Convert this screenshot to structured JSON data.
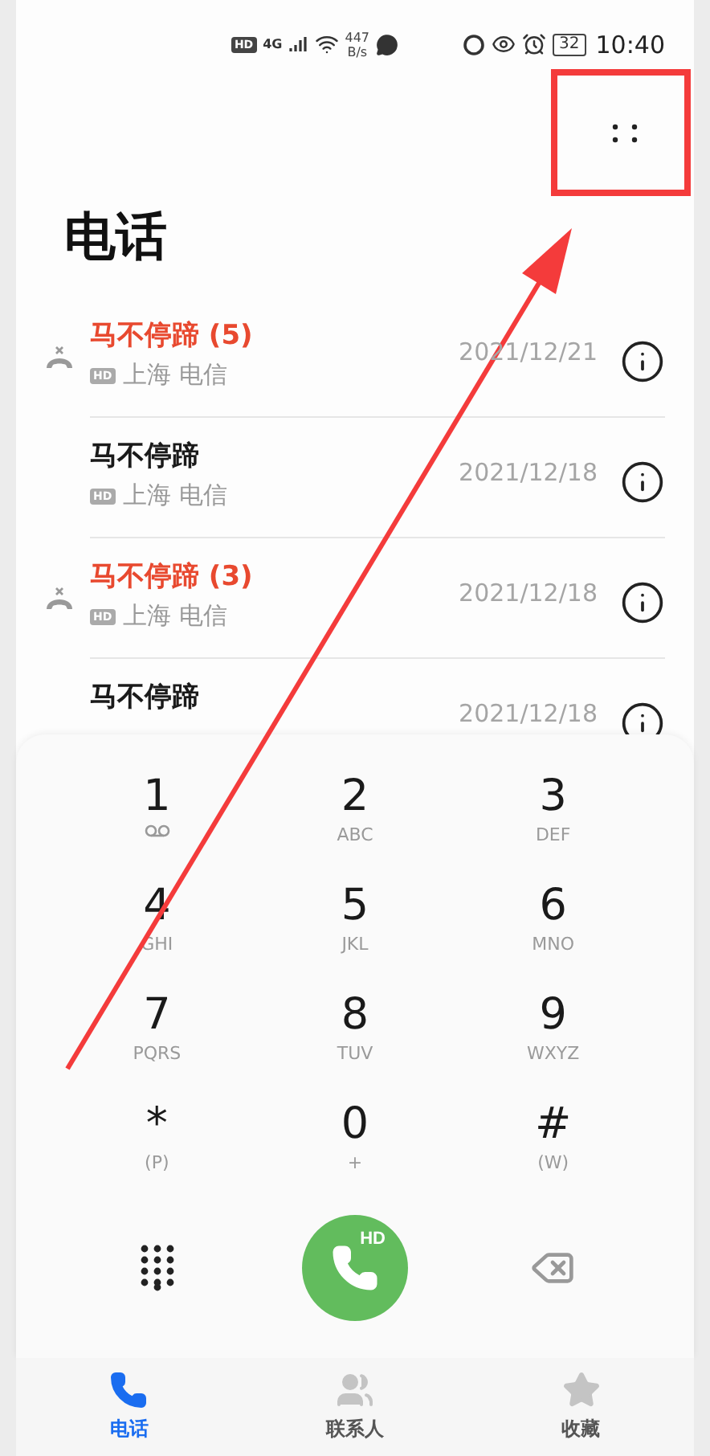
{
  "status_bar": {
    "hd": "HD",
    "network": "4G",
    "speed": "447",
    "speed_unit": "B/s",
    "battery": "32",
    "time": "10:40"
  },
  "title": "电话",
  "calls": [
    {
      "name": "马不停蹄 (5)",
      "missed": true,
      "badge": "HD",
      "location": "上海 电信",
      "date": "2021/12/21"
    },
    {
      "name": "马不停蹄",
      "missed": false,
      "badge": "HD",
      "location": "上海 电信",
      "date": "2021/12/18"
    },
    {
      "name": "马不停蹄 (3)",
      "missed": true,
      "badge": "HD",
      "location": "上海 电信",
      "date": "2021/12/18"
    },
    {
      "name": "马不停蹄",
      "missed": false,
      "date": "2021/12/18"
    }
  ],
  "keys": [
    {
      "digit": "1",
      "kind": "voicemail"
    },
    {
      "digit": "2",
      "kind": "letters",
      "sub": "ABC"
    },
    {
      "digit": "3",
      "kind": "letters",
      "sub": "DEF"
    },
    {
      "digit": "4",
      "kind": "letters",
      "sub": "GHI"
    },
    {
      "digit": "5",
      "kind": "letters",
      "sub": "JKL"
    },
    {
      "digit": "6",
      "kind": "letters",
      "sub": "MNO"
    },
    {
      "digit": "7",
      "kind": "letters",
      "sub": "PQRS"
    },
    {
      "digit": "8",
      "kind": "letters",
      "sub": "TUV"
    },
    {
      "digit": "9",
      "kind": "letters",
      "sub": "WXYZ"
    },
    {
      "digit": "*",
      "kind": "letters",
      "sub": "(P)"
    },
    {
      "digit": "0",
      "kind": "letters",
      "sub": "+"
    },
    {
      "digit": "#",
      "kind": "letters",
      "sub": "(W)"
    }
  ],
  "call_button": {
    "badge": "HD"
  },
  "tabs": [
    {
      "label": "电话",
      "kind": "phone",
      "selected": true
    },
    {
      "label": "联系人",
      "kind": "contacts",
      "selected": false
    },
    {
      "label": "收藏",
      "kind": "favorites",
      "selected": false
    }
  ]
}
